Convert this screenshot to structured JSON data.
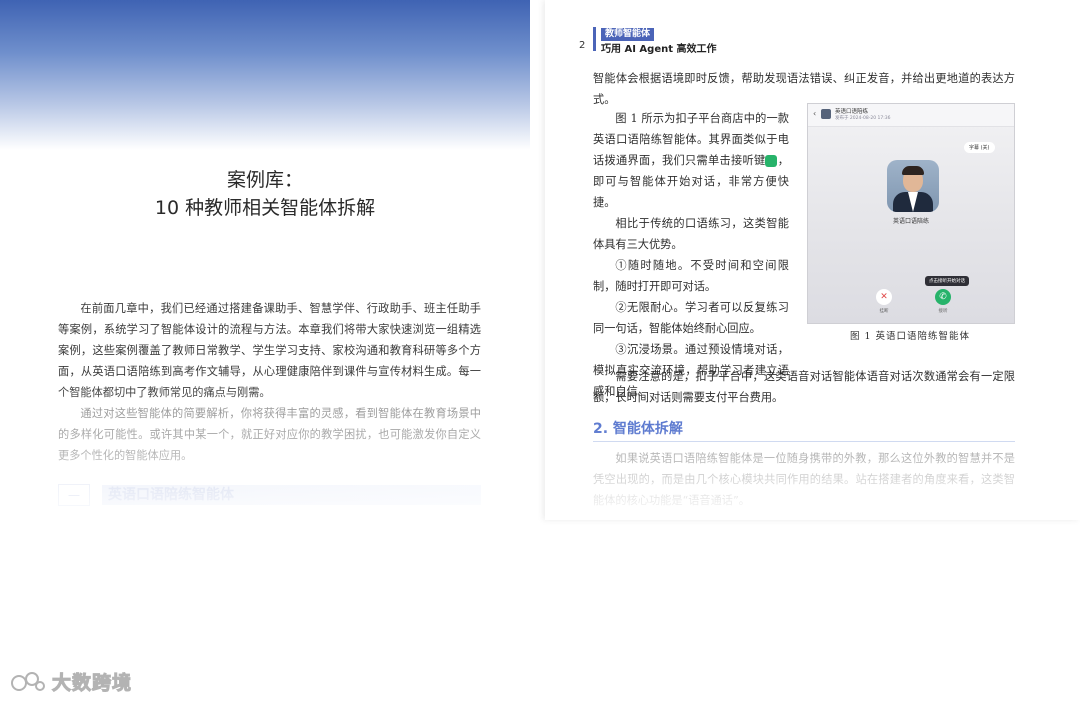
{
  "left_page": {
    "chapter_title_line1": "案例库：",
    "chapter_title_line2": "10 种教师相关智能体拆解",
    "intro_para1": "在前面几章中，我们已经通过搭建备课助手、智慧学伴、行政助手、班主任助手等案例，系统学习了智能体设计的流程与方法。本章我们将带大家快速浏览一组精选案例，这些案例覆盖了教师日常教学、学生学习支持、家校沟通和教育科研等多个方面，从英语口语陪练到高考作文辅导，从心理健康陪伴到课件与宣传材料生成。每一个智能体都切中了教师常见的痛点与刚需。",
    "intro_para2": "通过对这些智能体的简要解析，你将获得丰富的灵感，看到智能体在教育场景中的多样化可能性。或许其中某一个，就正好对应你的教学困扰，也可能激发你自定义更多个性化的智能体应用。",
    "case_number": "一",
    "case_title": "英语口语陪练智能体"
  },
  "right_page": {
    "page_number": "2",
    "header_tag": "教师智能体",
    "header_book": "巧用 AI Agent 高效工作",
    "para_top": "智能体会根据语境即时反馈，帮助发现语法错误、纠正发音，并给出更地道的表达方式。",
    "para_fig_intro_a": "图 1 所示为扣子平台商店中的一款英语口语陪练智能体。其界面类似于电话拨通界面，我们只需单击接听键",
    "para_fig_intro_b": "，即可与智能体开始对话，非常方便快捷。",
    "phone_key_glyph": "✆",
    "para_advantages": "相比于传统的口语练习，这类智能体具有三大优势。",
    "adv1": "①随时随地。不受时间和空间限制，随时打开即可对话。",
    "adv2": "②无限耐心。学习者可以反复练习同一句话，智能体始终耐心回应。",
    "adv3": "③沉浸场景。通过预设情境对话，模拟真实交流环境，帮助学习者建立语感和自信。",
    "para_note": "需要注意的是，扣子平台中，这类语音对话智能体语音对话次数通常会有一定限额，长时间对话则需要支付平台费用。",
    "section_heading": "2. 智能体拆解",
    "section_para": "如果说英语口语陪练智能体是一位随身携带的外教，那么这位外教的智慧并不是凭空出现的，而是由几个核心模块共同作用的结果。站在搭建者的角度来看，这类智能体的核心功能是“语音通话”。",
    "figure": {
      "back_glyph": "‹",
      "app_name": "英语口语陪练",
      "app_meta": "发布于 2024-08-20 17:36",
      "subtitle_button": "字幕 (关)",
      "agent_name": "英语口语陪练",
      "hint": "点击接听开始对话",
      "hangup_glyph": "✕",
      "hangup_label": "挂断",
      "answer_glyph": "✆",
      "answer_label": "接听",
      "caption": "图 1   英语口语陪练智能体"
    }
  },
  "watermark": {
    "text": "大数跨境"
  }
}
